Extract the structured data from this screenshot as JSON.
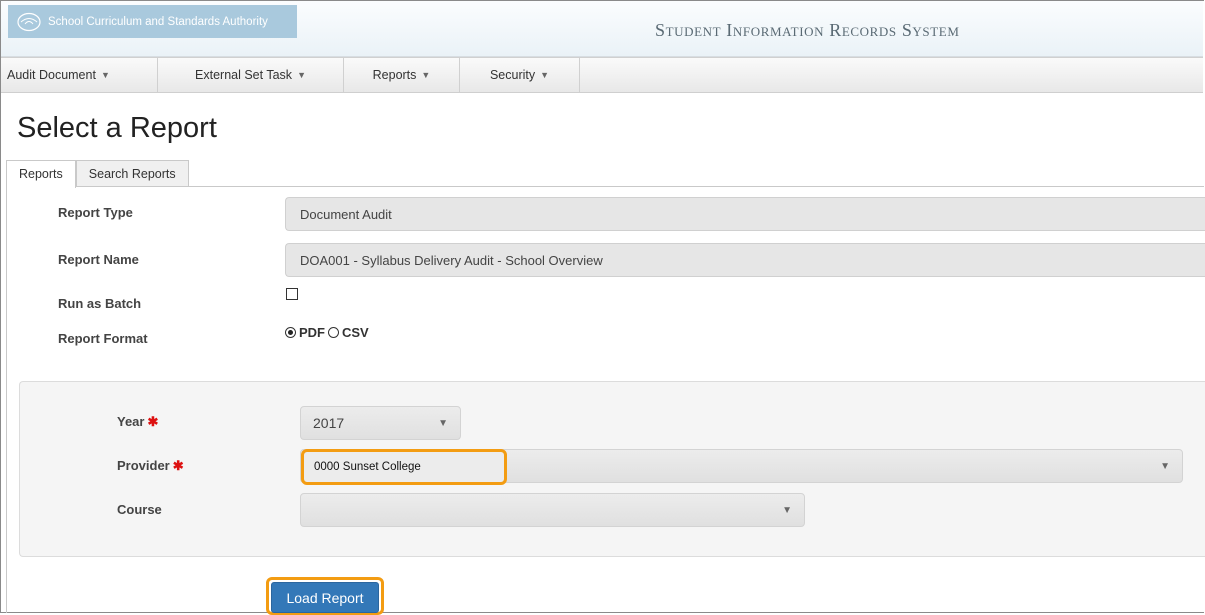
{
  "header": {
    "org_name": "School Curriculum and Standards Authority",
    "system_title": "Student Information Records System"
  },
  "nav": {
    "items": [
      {
        "label": "Audit Document"
      },
      {
        "label": "External Set Task"
      },
      {
        "label": "Reports"
      },
      {
        "label": "Security"
      }
    ]
  },
  "page": {
    "title": "Select a Report"
  },
  "tabs": [
    {
      "label": "Reports",
      "active": true
    },
    {
      "label": "Search Reports",
      "active": false
    }
  ],
  "form": {
    "report_type_label": "Report Type",
    "report_type_value": "Document Audit",
    "report_name_label": "Report Name",
    "report_name_value": "DOA001 - Syllabus Delivery Audit - School Overview",
    "run_as_batch_label": "Run as Batch",
    "run_as_batch_checked": false,
    "report_format_label": "Report Format",
    "format_options": [
      {
        "label": "PDF",
        "selected": true
      },
      {
        "label": "CSV",
        "selected": false
      }
    ]
  },
  "params": {
    "year_label": "Year",
    "year_value": "2017",
    "provider_label": "Provider",
    "provider_value": "0000 Sunset College",
    "course_label": "Course",
    "course_value": ""
  },
  "actions": {
    "load_report_label": "Load Report"
  },
  "colors": {
    "highlight": "#f39c12",
    "primary_button": "#3378b8",
    "required": "#dd1111",
    "logo_bg": "#a9c9dd"
  }
}
